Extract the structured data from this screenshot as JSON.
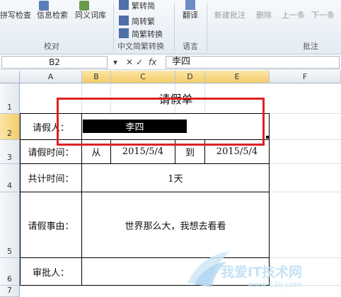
{
  "ribbon": {
    "proofing": {
      "spell_label": "拼写检查",
      "research_label": "信息检索",
      "thesaurus_label": "同义词库",
      "group_label": "校对"
    },
    "chinese": {
      "to_simp_label": "繁转简",
      "to_trad_label": "简转繁",
      "convert_label": "简繁转换",
      "group_label": "中文简繁转换"
    },
    "language": {
      "translate_label": "翻译",
      "group_label": "语言"
    },
    "comments": {
      "new_label": "新建批注",
      "delete_label": "删除",
      "prev_label": "上一条",
      "next_label": "下一条",
      "group_label": "批注"
    }
  },
  "formula_bar": {
    "name_box": "B2",
    "fx_label": "fx",
    "content": "李四"
  },
  "columns": [
    "A",
    "B",
    "C",
    "D",
    "E",
    "F"
  ],
  "rows": [
    "1",
    "2",
    "3",
    "4",
    "5",
    "6",
    "7"
  ],
  "sheet": {
    "title": "请假单",
    "applicant_label": "请假人：",
    "applicant_value": "李四",
    "time_label": "请假时间：",
    "from_label": "从",
    "from_date": "2015/5/4",
    "to_label": "到",
    "to_date": "2015/5/4",
    "total_label": "共计时间：",
    "total_value": "1天",
    "reason_label": "请假事由：",
    "reason_value": "世界那么大，我想去看看",
    "approver_label": "审批人："
  },
  "watermark": {
    "text": "我爱IT技术网",
    "url": "www.52ij.com"
  },
  "colors": {
    "highlight_box": "#e02020",
    "selection_header": "#f4cc6a"
  }
}
